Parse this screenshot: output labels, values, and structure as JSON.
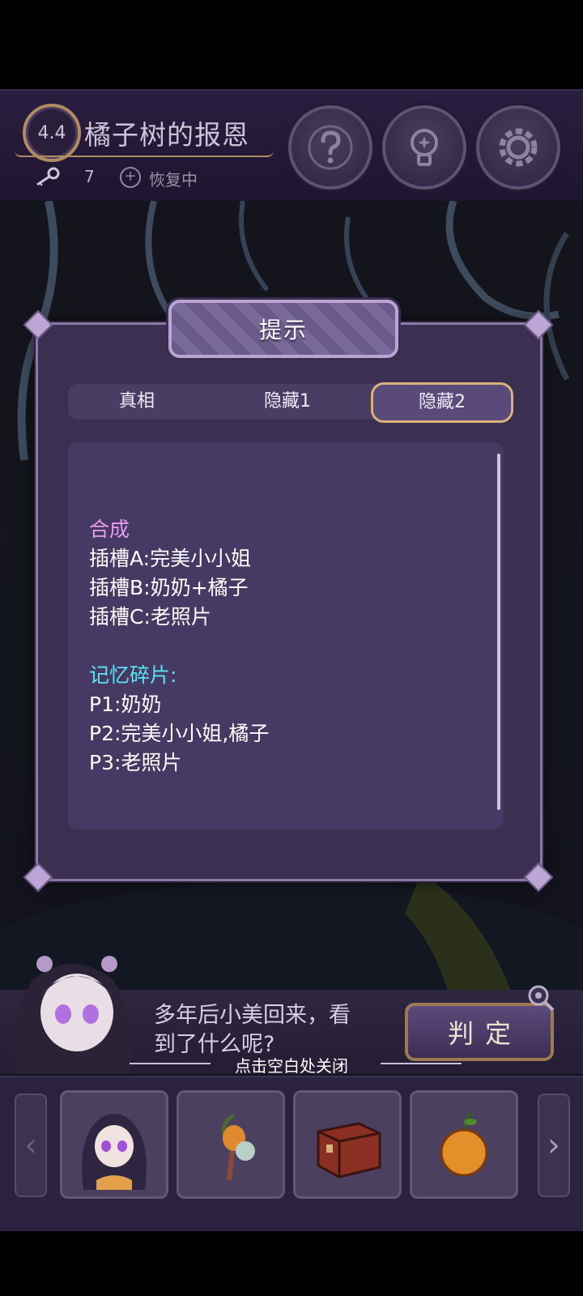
{
  "header": {
    "level": "4.4",
    "title": "橘子树的报恩",
    "key_count": "7",
    "recover_label": "恢复中",
    "buttons": [
      "help",
      "hint",
      "settings"
    ]
  },
  "dialog": {
    "title": "提示",
    "tabs": [
      {
        "label": "真相",
        "active": false
      },
      {
        "label": "隐藏1",
        "active": false
      },
      {
        "label": "隐藏2",
        "active": true
      }
    ],
    "content": {
      "section1_title": "合成",
      "section1_lines": [
        "插槽A:完美小小姐",
        "插槽B:奶奶+橘子",
        "插槽C:老照片"
      ],
      "section2_title": "记忆碎片:",
      "section2_lines": [
        "P1:奶奶",
        "P2:完美小小姐,橘子",
        "P3:老照片"
      ]
    }
  },
  "bottom": {
    "hint_line1": "多年后小美回来，看",
    "hint_line2": "到了什么呢?",
    "judge_label": "判定",
    "close_hint": "点击空白处关闭"
  },
  "inventory": {
    "left_arrow": "‹",
    "right_arrow": "›",
    "items": [
      "girl-portrait",
      "orange-tree-sprite",
      "wooden-chest",
      "orange"
    ]
  },
  "colors": {
    "accent_gold": "#d8b27a",
    "panel_purple": "#3b3051",
    "section_purple": "#e79cf0",
    "section_cyan": "#59e5f5"
  }
}
